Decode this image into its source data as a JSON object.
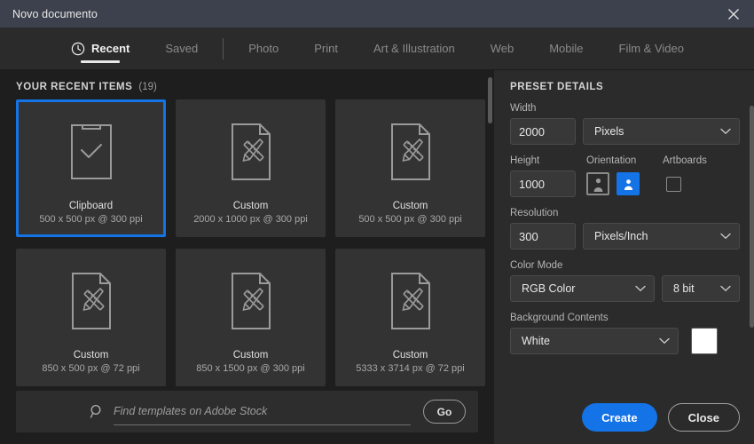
{
  "window": {
    "title": "Novo documento",
    "close_icon": "close-icon"
  },
  "tabs": [
    {
      "label": "Recent",
      "icon": "clock-icon",
      "active": true
    },
    {
      "label": "Saved",
      "active": false
    },
    {
      "label": "Photo",
      "active": false
    },
    {
      "label": "Print",
      "active": false
    },
    {
      "label": "Art & Illustration",
      "active": false
    },
    {
      "label": "Web",
      "active": false
    },
    {
      "label": "Mobile",
      "active": false
    },
    {
      "label": "Film & Video",
      "active": false
    }
  ],
  "recent": {
    "heading": "YOUR RECENT ITEMS",
    "count": "(19)",
    "items": [
      {
        "name": "Clipboard",
        "dims": "500 x 500 px @ 300 ppi",
        "icon": "clipboard-check-icon",
        "selected": true
      },
      {
        "name": "Custom",
        "dims": "2000 x 1000 px @ 300 ppi",
        "icon": "document-pencil-ruler-icon",
        "selected": false
      },
      {
        "name": "Custom",
        "dims": "500 x 500 px @ 300 ppi",
        "icon": "document-pencil-ruler-icon",
        "selected": false
      },
      {
        "name": "Custom",
        "dims": "850 x 500 px @ 72 ppi",
        "icon": "document-pencil-ruler-icon",
        "selected": false
      },
      {
        "name": "Custom",
        "dims": "850 x 1500 px @ 300 ppi",
        "icon": "document-pencil-ruler-icon",
        "selected": false
      },
      {
        "name": "Custom",
        "dims": "5333 x 3714 px @ 72 ppi",
        "icon": "document-pencil-ruler-icon",
        "selected": false
      }
    ]
  },
  "search": {
    "icon": "search-icon",
    "placeholder": "Find templates on Adobe Stock",
    "value": "",
    "go_label": "Go"
  },
  "preset": {
    "heading": "PRESET DETAILS",
    "width_label": "Width",
    "width_value": "2000",
    "width_unit": "Pixels",
    "height_label": "Height",
    "height_value": "1000",
    "orientation_label": "Orientation",
    "orientation_portrait": "portrait-icon",
    "orientation_landscape": "landscape-icon",
    "artboards_label": "Artboards",
    "artboards_checked": false,
    "resolution_label": "Resolution",
    "resolution_value": "300",
    "resolution_unit": "Pixels/Inch",
    "color_mode_label": "Color Mode",
    "color_mode_value": "RGB Color",
    "bit_depth_value": "8 bit",
    "background_label": "Background Contents",
    "background_value": "White",
    "background_swatch_color": "#ffffff"
  },
  "actions": {
    "create_label": "Create",
    "close_label": "Close"
  },
  "colors": {
    "accent": "#1473e6",
    "titlebar_bg": "#3c414d",
    "tabbar_bg": "#2b2b2b",
    "left_bg": "#1e1e1e",
    "right_bg": "#2b2b2b",
    "card_bg": "#333333"
  }
}
